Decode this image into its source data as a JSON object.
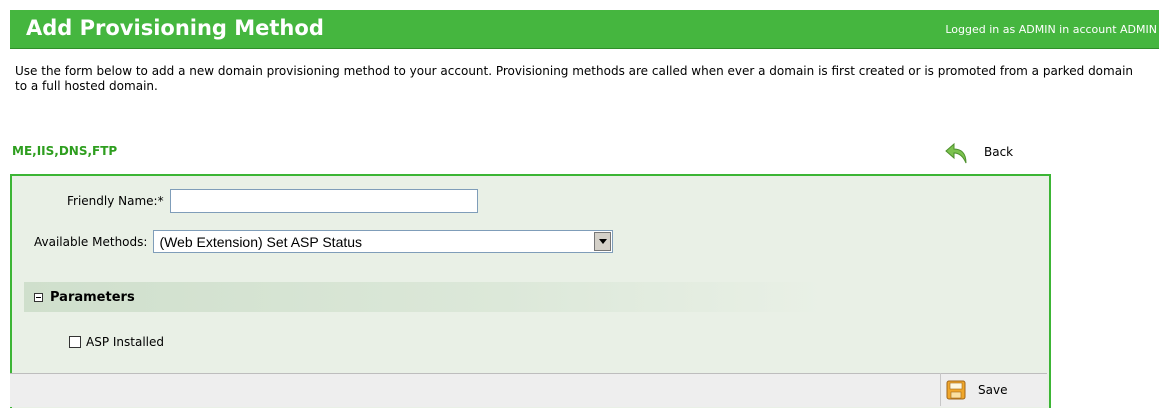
{
  "header": {
    "title": "Add Provisioning Method",
    "login_text": "Logged in as ADMIN in account ADMIN"
  },
  "intro": {
    "text": "Use the form below to add a new domain provisioning method to your account. Provisioning methods are called when ever a domain is first created or is promoted from a parked domain to a full hosted domain."
  },
  "section": {
    "tag": "ME,IIS,DNS,FTP"
  },
  "toolbar": {
    "back_label": "Back",
    "save_label": "Save"
  },
  "form": {
    "friendly_name_label": "Friendly Name:*",
    "friendly_name_value": "",
    "available_methods_label": "Available Methods:",
    "available_methods_value": "(Web Extension) Set ASP Status"
  },
  "parameters": {
    "label": "Parameters",
    "asp_installed_label": "ASP Installed",
    "asp_installed_checked": false
  },
  "colors": {
    "header": "#45b63f",
    "accent_text": "#2e9e1f",
    "panel_border": "#3cb535",
    "panel_bg": "#e9f0e6"
  }
}
